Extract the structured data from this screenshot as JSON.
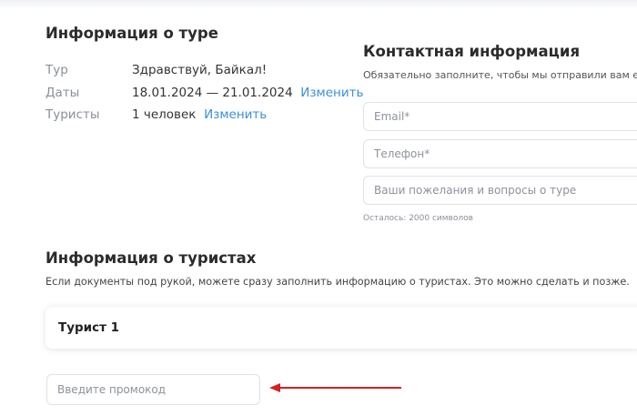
{
  "tour_info": {
    "title": "Информация о туре",
    "rows": [
      {
        "label": "Тур",
        "value": "Здравствуй, Байкал!",
        "link": ""
      },
      {
        "label": "Даты",
        "value": "18.01.2024 — 21.01.2024",
        "link": "Изменить"
      },
      {
        "label": "Туристы",
        "value": "1 человек",
        "link": "Изменить"
      }
    ]
  },
  "contact": {
    "title": "Контактная информация",
    "subtitle": "Обязательно заполните, чтобы мы отправили вам е",
    "email_placeholder": "Email*",
    "phone_placeholder": "Телефон*",
    "wishes_placeholder": "Ваши пожелания и вопросы о туре",
    "counter": "Осталось: 2000 символов"
  },
  "tourists": {
    "title": "Информация о туристах",
    "subtitle": "Если документы под рукой, можете сразу заполнить информацию о туристах. Это можно сделать и позже.",
    "cards": [
      {
        "label": "Турист 1"
      }
    ]
  },
  "promo": {
    "placeholder": "Введите промокод"
  },
  "colors": {
    "link": "#3b8fd9",
    "arrow": "#d62020"
  },
  "icons": {
    "annotation": "red-arrow-icon"
  }
}
